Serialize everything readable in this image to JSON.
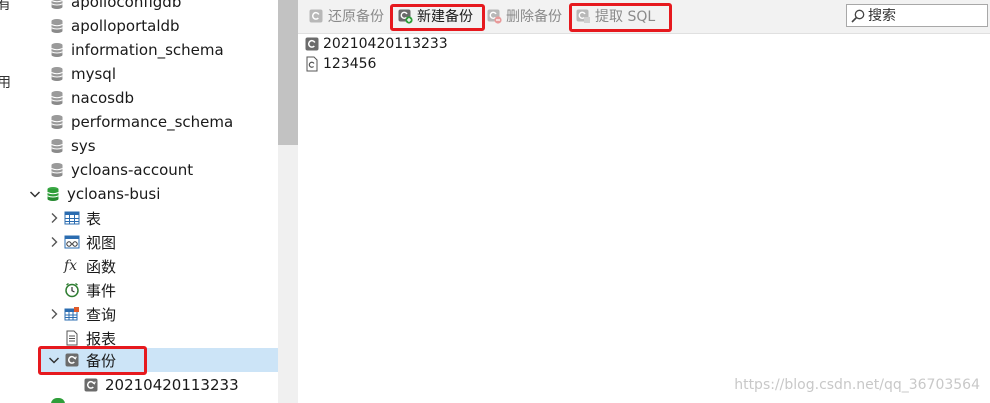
{
  "left_gutter": {
    "chars": [
      "有",
      "用"
    ]
  },
  "tree": {
    "databases": [
      {
        "label": "apolloconfigdb"
      },
      {
        "label": "apolloportaldb"
      },
      {
        "label": "information_schema"
      },
      {
        "label": "mysql"
      },
      {
        "label": "nacosdb"
      },
      {
        "label": "performance_schema"
      },
      {
        "label": "sys"
      },
      {
        "label": "ycloans-account"
      }
    ],
    "open_database": {
      "label": "ycloans-busi"
    },
    "children": [
      {
        "label": "表"
      },
      {
        "label": "视图"
      },
      {
        "label": "函数"
      },
      {
        "label": "事件"
      },
      {
        "label": "查询"
      },
      {
        "label": "报表"
      },
      {
        "label": "备份"
      }
    ],
    "backup_child": {
      "label": "20210420113233"
    }
  },
  "toolbar": {
    "restore_label": "还原备份",
    "new_label": "新建备份",
    "delete_label": "删除备份",
    "extract_label": "提取 SQL",
    "search_placeholder": "搜索"
  },
  "files": [
    {
      "label": "20210420113233"
    },
    {
      "label": "123456"
    }
  ],
  "watermark": "https://blog.csdn.net/qq_36703564",
  "colors": {
    "highlight_red": "#e6191e",
    "selected_row": "#cce4f7",
    "db_green": "#2f9e3a"
  }
}
